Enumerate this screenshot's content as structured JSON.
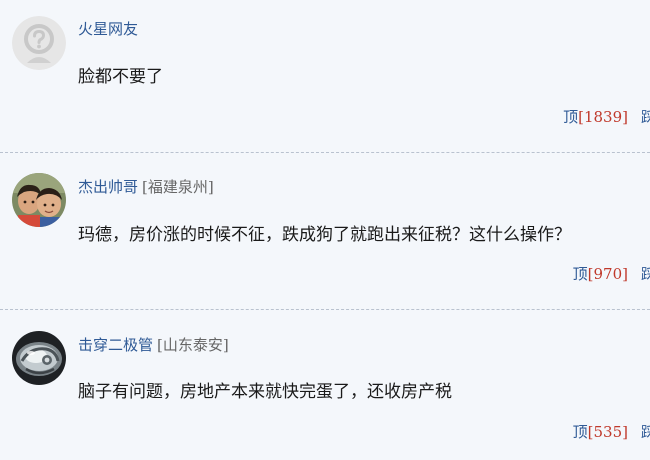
{
  "comments": [
    {
      "username": "火星网友",
      "location": "",
      "avatar_icon": "default-user-avatar-icon",
      "content": "脸都不要了",
      "up_label": "顶",
      "up_count": "[1839]",
      "cut_label": "踩"
    },
    {
      "username": "杰出帅哥",
      "location": "[福建泉州]",
      "avatar_icon": "two-children-photo-avatar",
      "content": "玛德，房价涨的时候不征，跌成狗了就跑出来征税？这什么操作？",
      "up_label": "顶",
      "up_count": "[970]",
      "cut_label": "踩"
    },
    {
      "username": "击穿二极管",
      "location": "[山东泰安]",
      "avatar_icon": "metal-emblem-photo-avatar",
      "content": "脑子有问题，房地产本来就快完蛋了，还收房产税",
      "up_label": "顶",
      "up_count": "[535]",
      "cut_label": "踩"
    }
  ],
  "colors": {
    "background": "#f4f7fb",
    "username": "#2f5a96",
    "count": "#c0392b",
    "divider": "#b9c2cf"
  }
}
